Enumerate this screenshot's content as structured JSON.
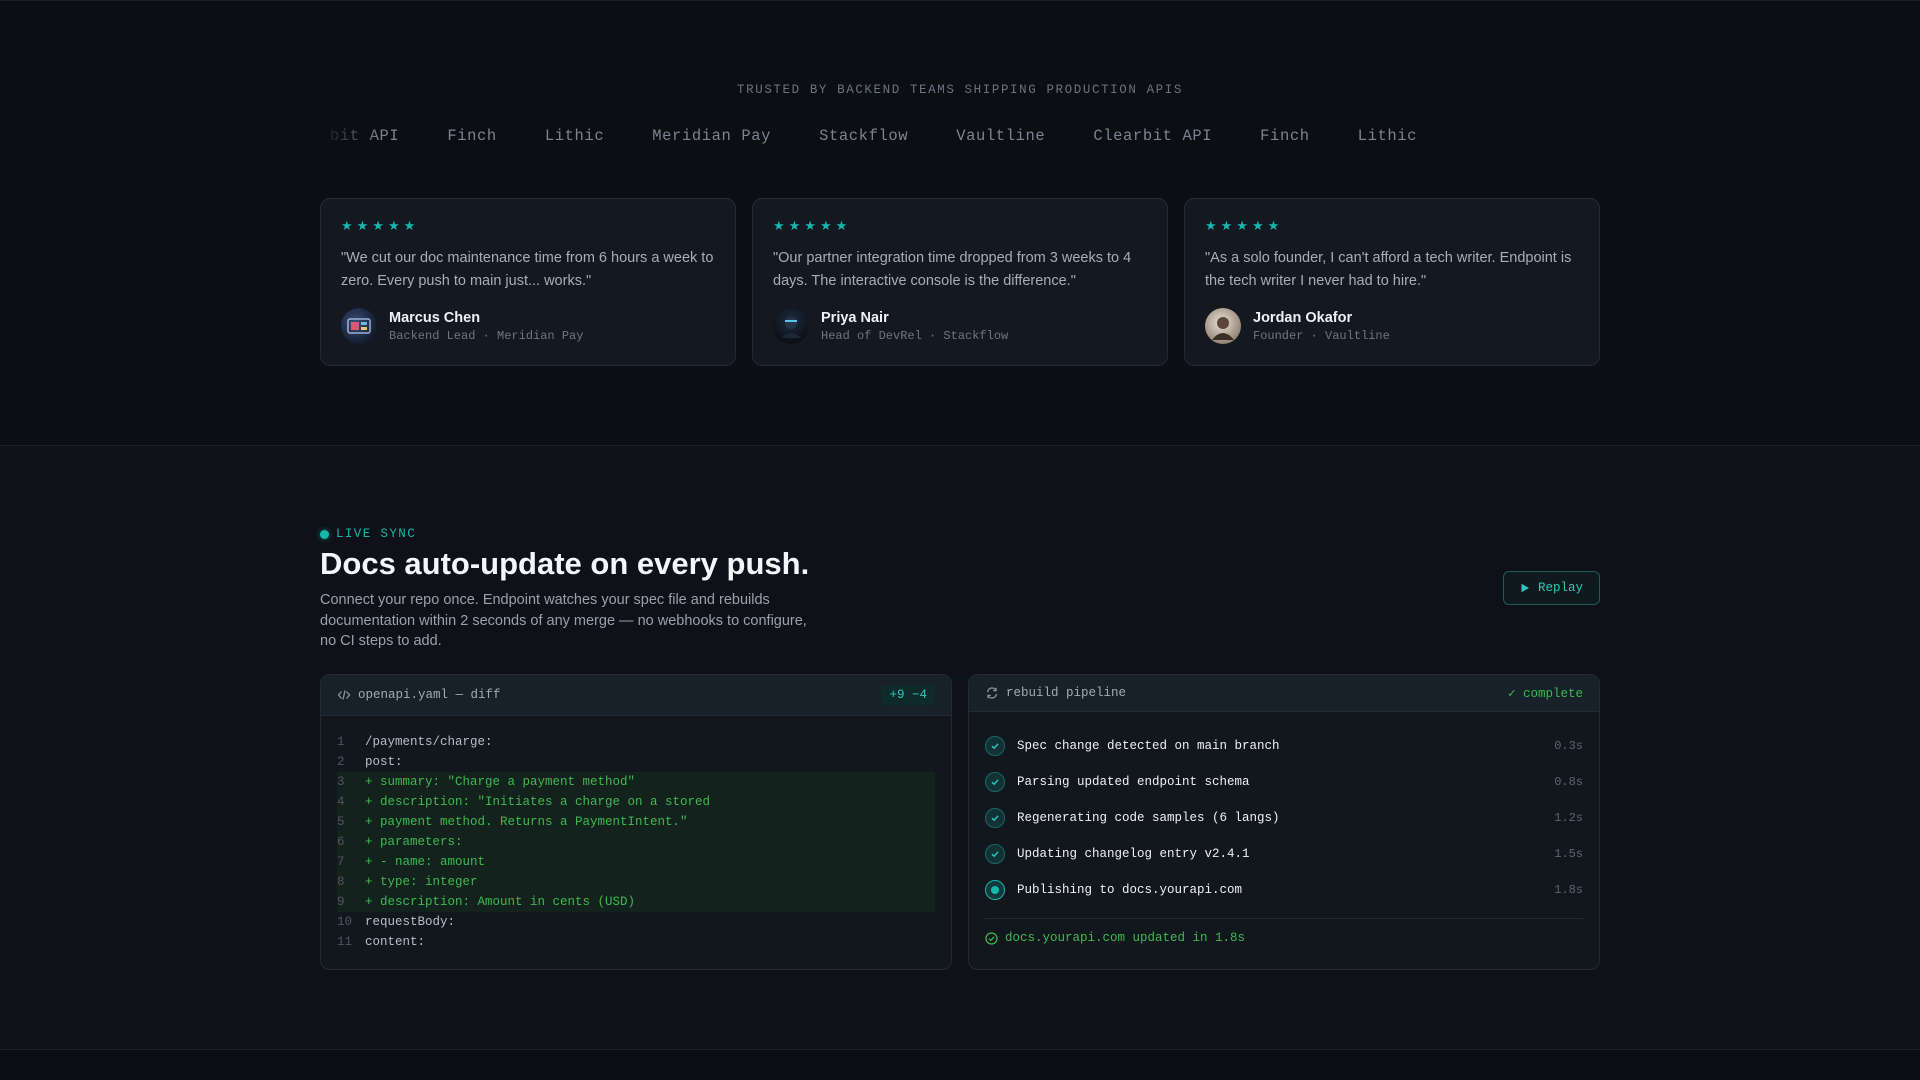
{
  "testimonials": {
    "trusted_label": "TRUSTED BY BACKEND TEAMS SHIPPING PRODUCTION APIS",
    "logos": [
      "bit API",
      "Finch",
      "Lithic",
      "Meridian Pay",
      "Stackflow",
      "Vaultline",
      "Clearbit API",
      "Finch",
      "Lithic"
    ],
    "cards": [
      {
        "stars": "★★★★★",
        "quote": "\"We cut our doc maintenance time from 6 hours a week to zero. Every push to main just... works.\"",
        "name": "Marcus Chen",
        "role": "Backend Lead · Meridian Pay"
      },
      {
        "stars": "★★★★★",
        "quote": "\"Our partner integration time dropped from 3 weeks to 4 days. The interactive console is the difference.\"",
        "name": "Priya Nair",
        "role": "Head of DevRel · Stackflow"
      },
      {
        "stars": "★★★★★",
        "quote": "\"As a solo founder, I can't afford a tech writer. Endpoint is the tech writer I never had to hire.\"",
        "name": "Jordan Okafor",
        "role": "Founder · Vaultline"
      }
    ]
  },
  "sync": {
    "badge": "LIVE SYNC",
    "headline": "Docs auto-update on every push.",
    "subcopy": "Connect your repo once. Endpoint watches your spec file and rebuilds documentation within 2 seconds of any merge — no webhooks to configure, no CI steps to add.",
    "replay_label": "Replay",
    "diff": {
      "title": "openapi.yaml — diff",
      "stat": "+9 −4",
      "lines": [
        {
          "n": "1",
          "text": "/payments/charge:",
          "added": false
        },
        {
          "n": "2",
          "text": "post:",
          "added": false
        },
        {
          "n": "3",
          "text": "+ summary: \"Charge a payment method\"",
          "added": true
        },
        {
          "n": "4",
          "text": "+ description: \"Initiates a charge on a stored",
          "added": true
        },
        {
          "n": "5",
          "text": "+ payment method. Returns a PaymentIntent.\"",
          "added": true
        },
        {
          "n": "6",
          "text": "+ parameters:",
          "added": true
        },
        {
          "n": "7",
          "text": "+ - name: amount",
          "added": true
        },
        {
          "n": "8",
          "text": "+ type: integer",
          "added": true
        },
        {
          "n": "9",
          "text": "+ description: Amount in cents (USD)",
          "added": true
        },
        {
          "n": "10",
          "text": "requestBody:",
          "added": false
        },
        {
          "n": "11",
          "text": "content:",
          "added": false
        }
      ]
    },
    "pipeline": {
      "title": "rebuild pipeline",
      "status": "✓ complete",
      "steps": [
        {
          "label": "Spec change detected on main branch",
          "time": "0.3s",
          "state": "done"
        },
        {
          "label": "Parsing updated endpoint schema",
          "time": "0.8s",
          "state": "done"
        },
        {
          "label": "Regenerating code samples (6 langs)",
          "time": "1.2s",
          "state": "done"
        },
        {
          "label": "Updating changelog entry v2.4.1",
          "time": "1.5s",
          "state": "done"
        },
        {
          "label": "Publishing to docs.yourapi.com",
          "time": "1.8s",
          "state": "active"
        }
      ],
      "result": "docs.yourapi.com updated in 1.8s"
    }
  },
  "colors": {
    "accent": "#16b7ad",
    "success": "#3fb950",
    "background": "#0b0e13"
  }
}
